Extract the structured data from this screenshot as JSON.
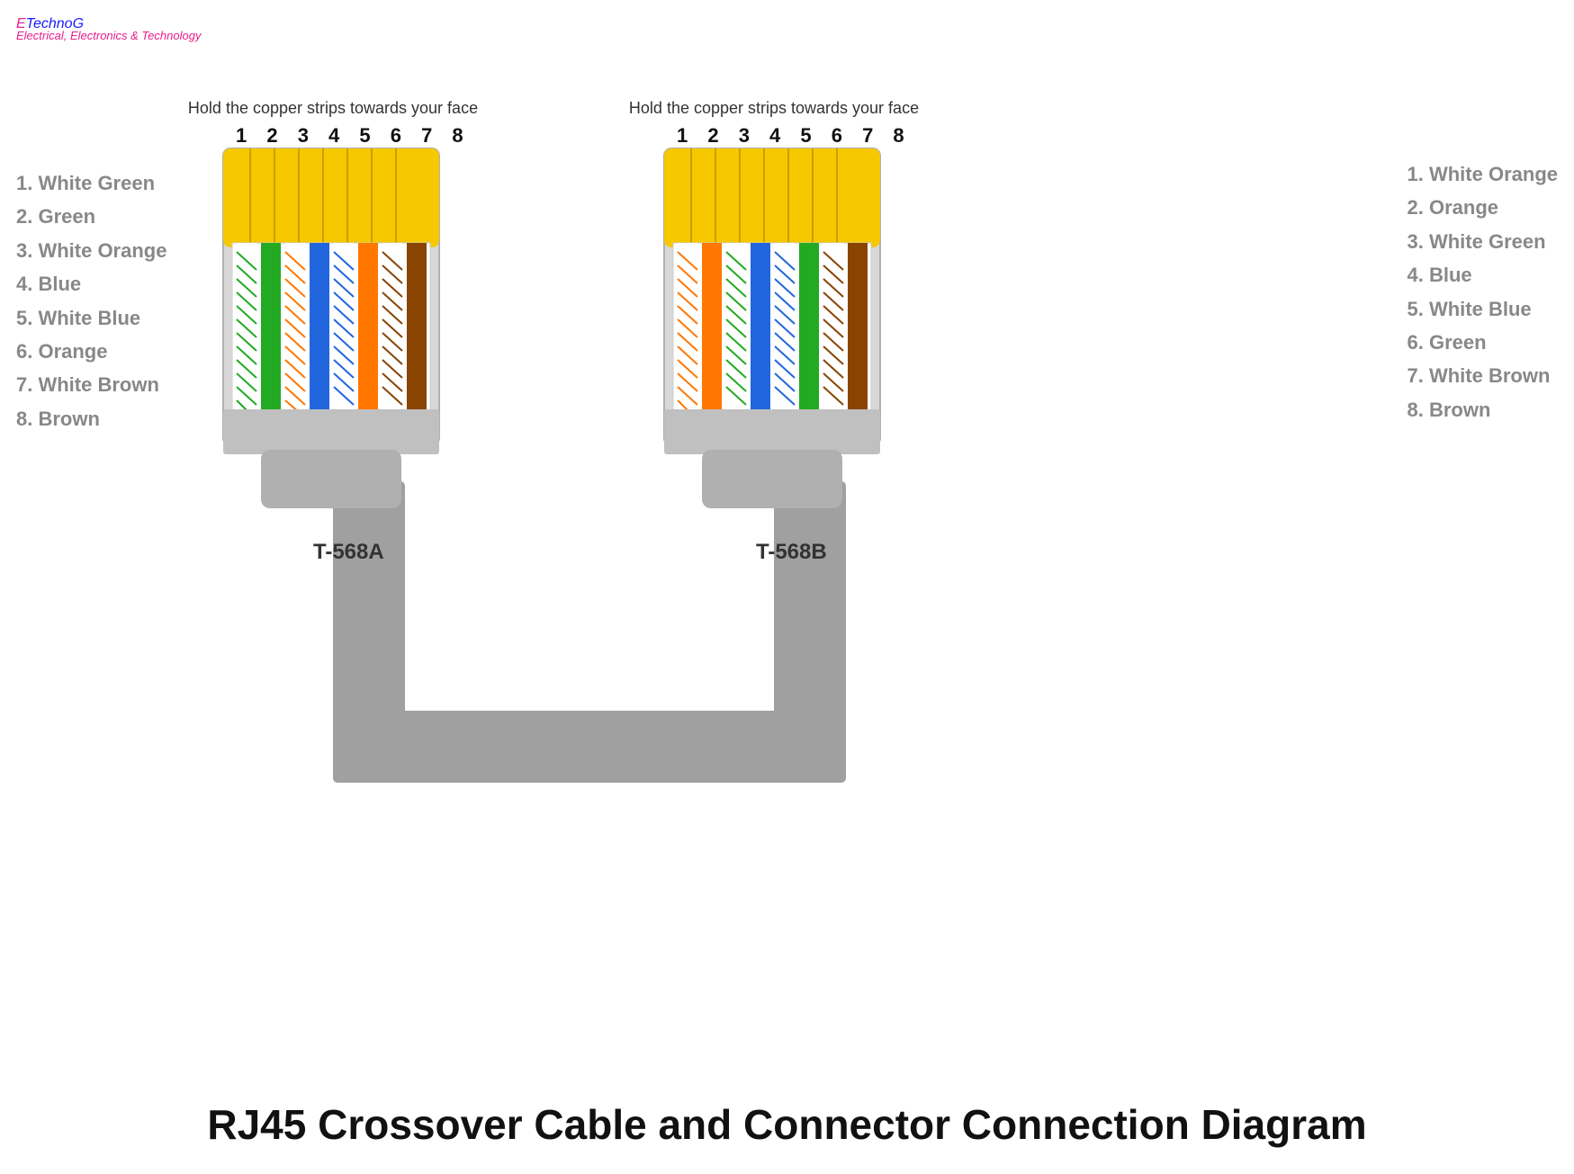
{
  "logo": {
    "e": "E",
    "technog": "TechnoG",
    "subtitle": "Electrical, Electronics & Technology"
  },
  "title": "RJ45 Crossover Cable and Connector Connection Diagram",
  "instruction": "Hold the copper strips towards your face",
  "pin_numbers": "1 2 3 4 5 6 7 8",
  "left_connector": {
    "label": "T-568A",
    "wires": [
      {
        "num": "1.",
        "name": "White Green"
      },
      {
        "num": "2.",
        "name": "Green"
      },
      {
        "num": "3.",
        "name": "White Orange"
      },
      {
        "num": "4.",
        "name": "Blue"
      },
      {
        "num": "5.",
        "name": "White Blue"
      },
      {
        "num": "6.",
        "name": "Orange"
      },
      {
        "num": "7.",
        "name": "White Brown"
      },
      {
        "num": "8.",
        "name": "Brown"
      }
    ]
  },
  "right_connector": {
    "label": "T-568B",
    "wires": [
      {
        "num": "1.",
        "name": "White Orange"
      },
      {
        "num": "2.",
        "name": "Orange"
      },
      {
        "num": "3.",
        "name": "White Green"
      },
      {
        "num": "4.",
        "name": "Blue"
      },
      {
        "num": "5.",
        "name": "White Blue"
      },
      {
        "num": "6.",
        "name": "Green"
      },
      {
        "num": "7.",
        "name": "White Brown"
      },
      {
        "num": "8.",
        "name": "Brown"
      }
    ]
  },
  "colors": {
    "accent_pink": "#e91e8c",
    "accent_blue": "#1a1aff",
    "gray_label": "#888888",
    "connector_bg": "#c8c8c8",
    "connector_border": "#aaaaaa"
  }
}
